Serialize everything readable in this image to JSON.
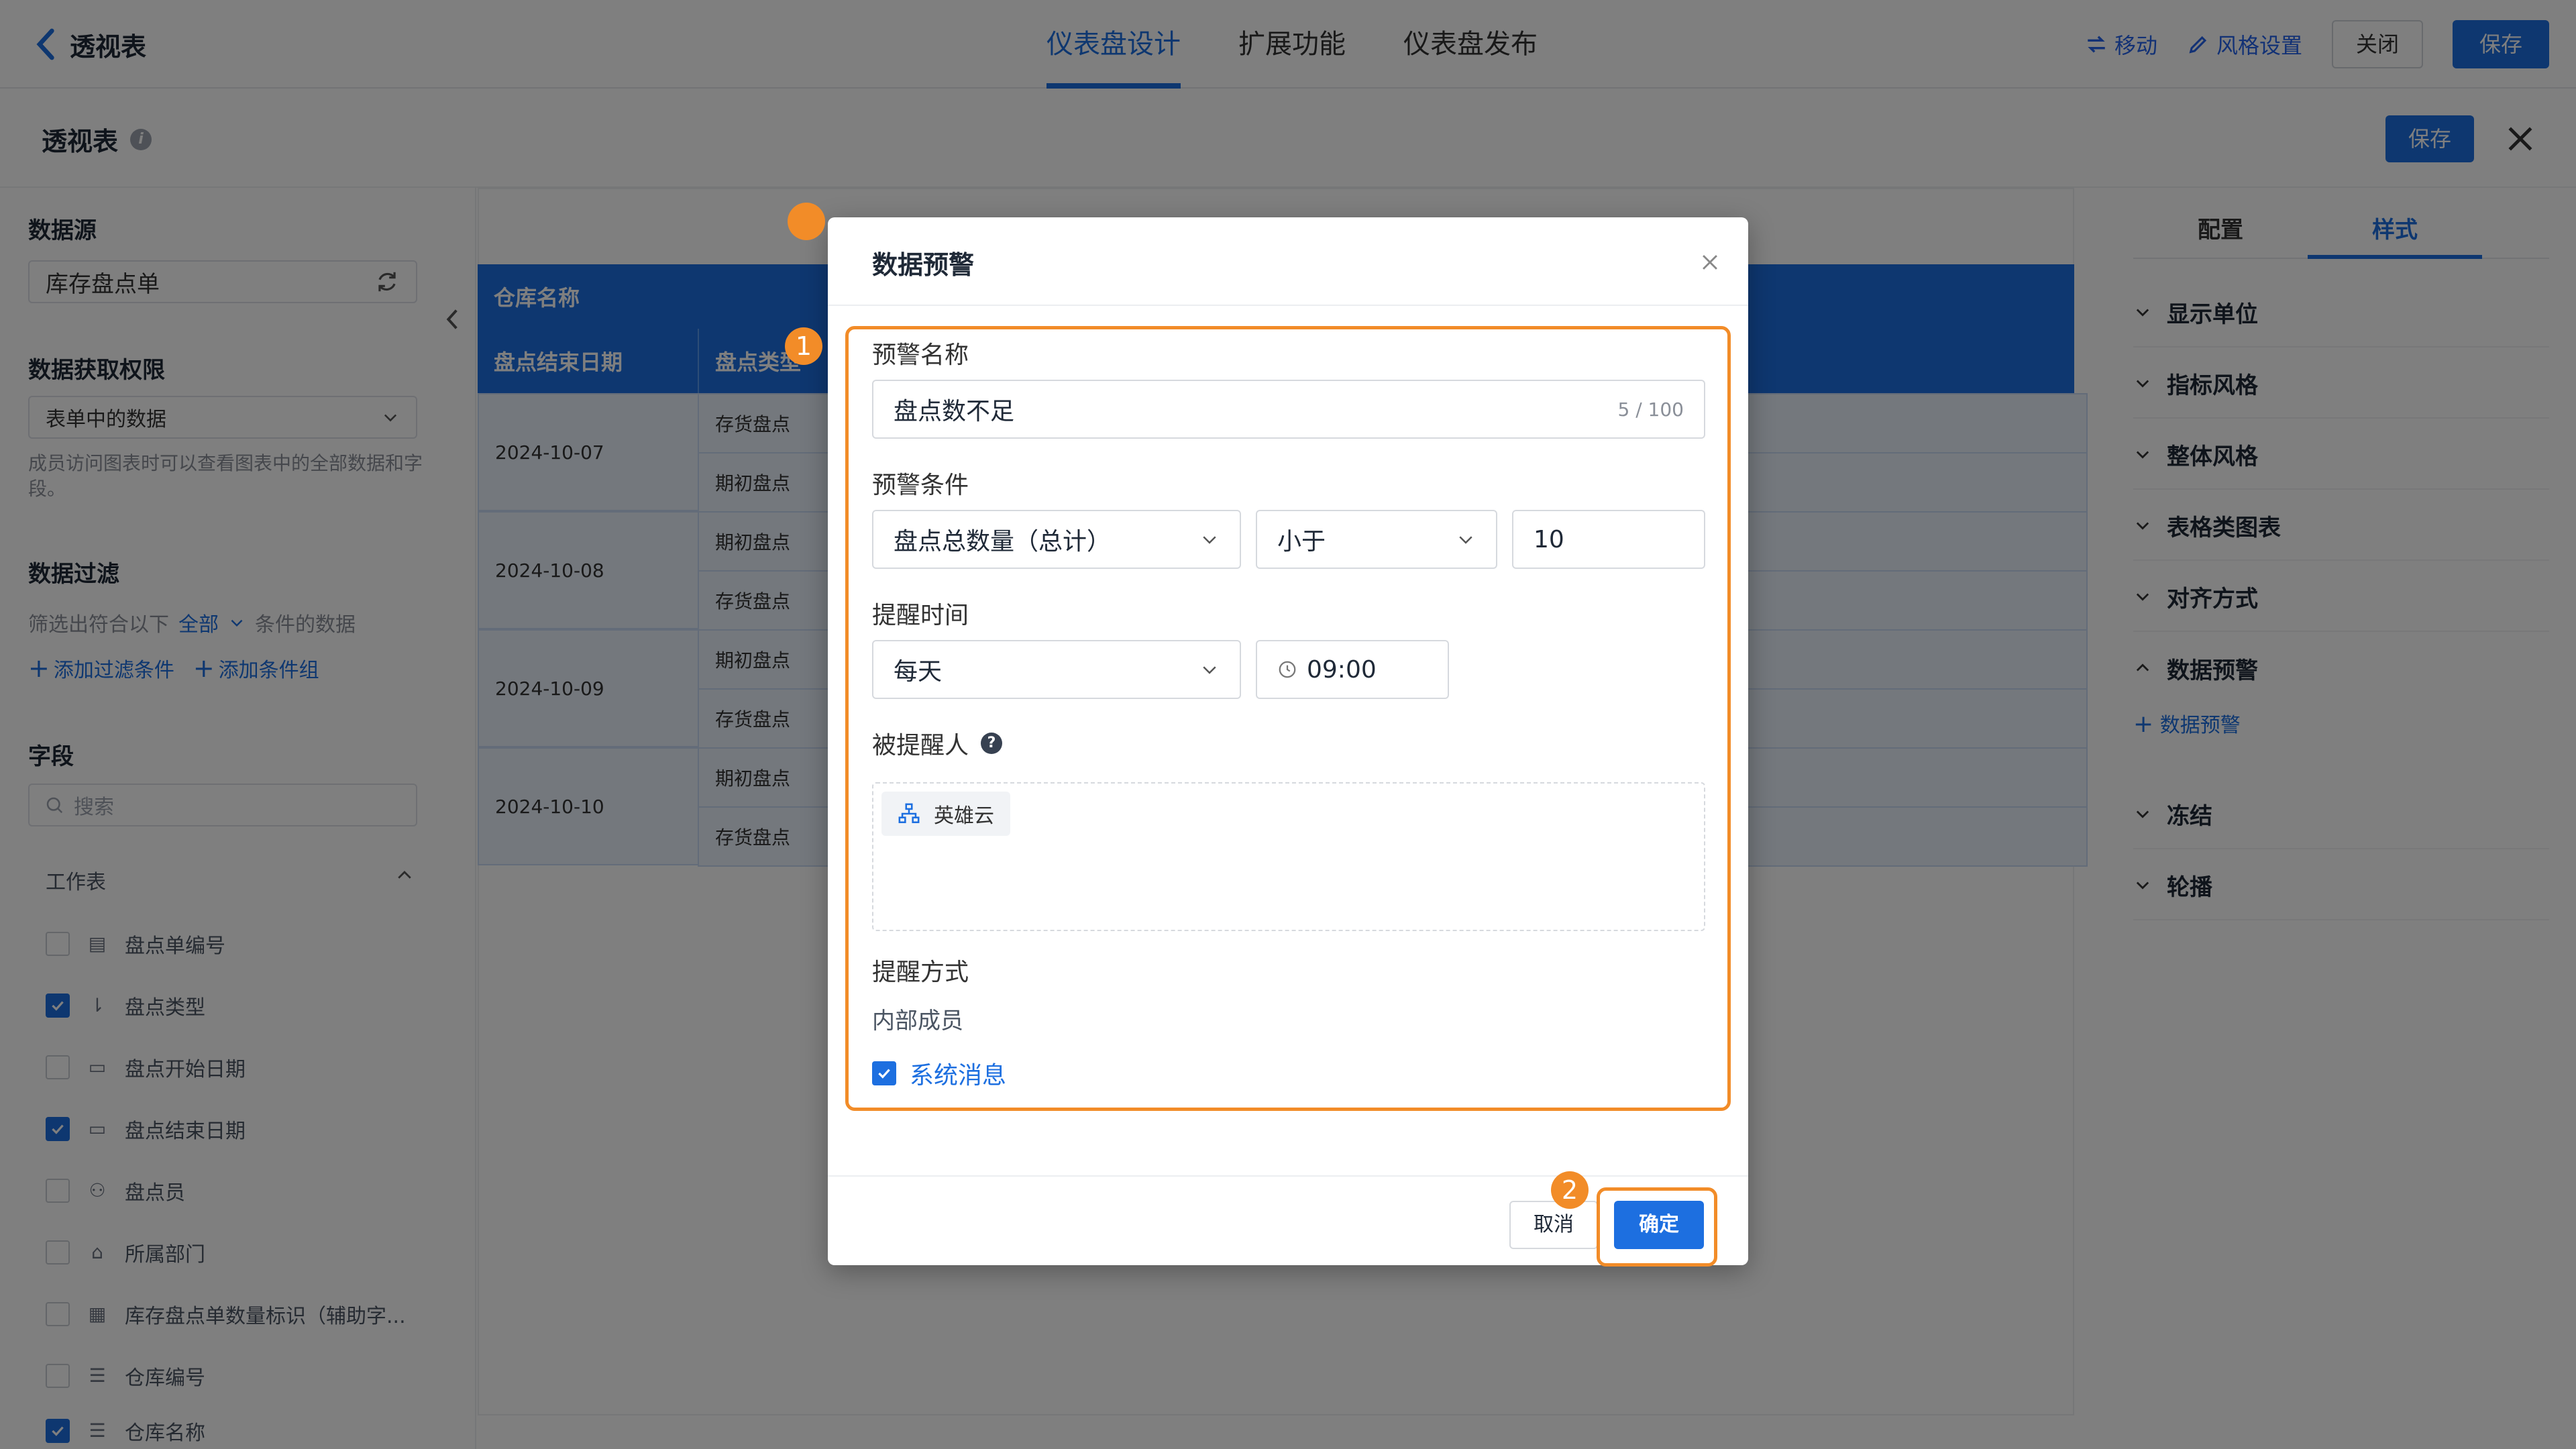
{
  "topbar": {
    "back_title": "透视表",
    "tabs": [
      "仪表盘设计",
      "扩展功能",
      "仪表盘发布"
    ],
    "actions": {
      "move": "移动",
      "style": "风格设置",
      "close": "关闭",
      "save": "保存"
    }
  },
  "panel": {
    "title": "透视表",
    "save": "保存"
  },
  "left": {
    "datasource_title": "数据源",
    "datasource_value": "库存盘点单",
    "permission_title": "数据获取权限",
    "permission_value": "表单中的数据",
    "permission_hint": "成员访问图表时可以查看图表中的全部数据和字段。",
    "filter_title": "数据过滤",
    "filter_prefix": "筛选出符合以下",
    "filter_mode": "全部",
    "filter_suffix": "条件的数据",
    "add_filter": "添加过滤条件",
    "add_group": "添加条件组",
    "fields_title": "字段",
    "search_placeholder": "搜索",
    "group_name": "工作表",
    "fields": [
      {
        "label": "盘点单编号",
        "checked": false,
        "icon": "text-icon"
      },
      {
        "label": "盘点类型",
        "checked": true,
        "icon": "sort-icon"
      },
      {
        "label": "盘点开始日期",
        "checked": false,
        "icon": "calendar-icon"
      },
      {
        "label": "盘点结束日期",
        "checked": true,
        "icon": "calendar-icon"
      },
      {
        "label": "盘点员",
        "checked": false,
        "icon": "user-icon"
      },
      {
        "label": "所属部门",
        "checked": false,
        "icon": "department-icon"
      },
      {
        "label": "库存盘点单数量标识（辅助字...",
        "checked": false,
        "icon": "number-icon"
      },
      {
        "label": "仓库编号",
        "checked": false,
        "icon": "lines-icon"
      },
      {
        "label": "仓库名称",
        "checked": true,
        "icon": "lines-icon"
      }
    ]
  },
  "table": {
    "header_top": "仓库名称",
    "header_date": "盘点结束日期",
    "header_type": "盘点类型",
    "rows": [
      {
        "date": "2024-10-07",
        "types": [
          "存货盘点",
          "期初盘点"
        ]
      },
      {
        "date": "2024-10-08",
        "types": [
          "期初盘点",
          "存货盘点"
        ]
      },
      {
        "date": "2024-10-09",
        "types": [
          "期初盘点",
          "存货盘点"
        ]
      },
      {
        "date": "2024-10-10",
        "types": [
          "期初盘点",
          "存货盘点"
        ]
      }
    ]
  },
  "right": {
    "tabs": [
      "配置",
      "样式"
    ],
    "items": [
      "显示单位",
      "指标风格",
      "整体风格",
      "表格类图表",
      "对齐方式",
      "数据预警",
      "冻结",
      "轮播"
    ],
    "add_alert": "数据预警"
  },
  "modal": {
    "title": "数据预警",
    "name_label": "预警名称",
    "name_value": "盘点数不足",
    "name_count": "5 / 100",
    "condition_label": "预警条件",
    "condition_field": "盘点总数量（总计）",
    "condition_op": "小于",
    "condition_value": "10",
    "time_label": "提醒时间",
    "time_freq": "每天",
    "time_value": "09:00",
    "recipient_label": "被提醒人",
    "recipient_tag": "英雄云",
    "method_label": "提醒方式",
    "method_sub": "内部成员",
    "method_option": "系统消息",
    "cancel": "取消",
    "ok": "确定",
    "badge1": "1",
    "badge2": "2"
  },
  "colors": {
    "primary": "#1d6fe0",
    "highlight": "#f28c28"
  }
}
